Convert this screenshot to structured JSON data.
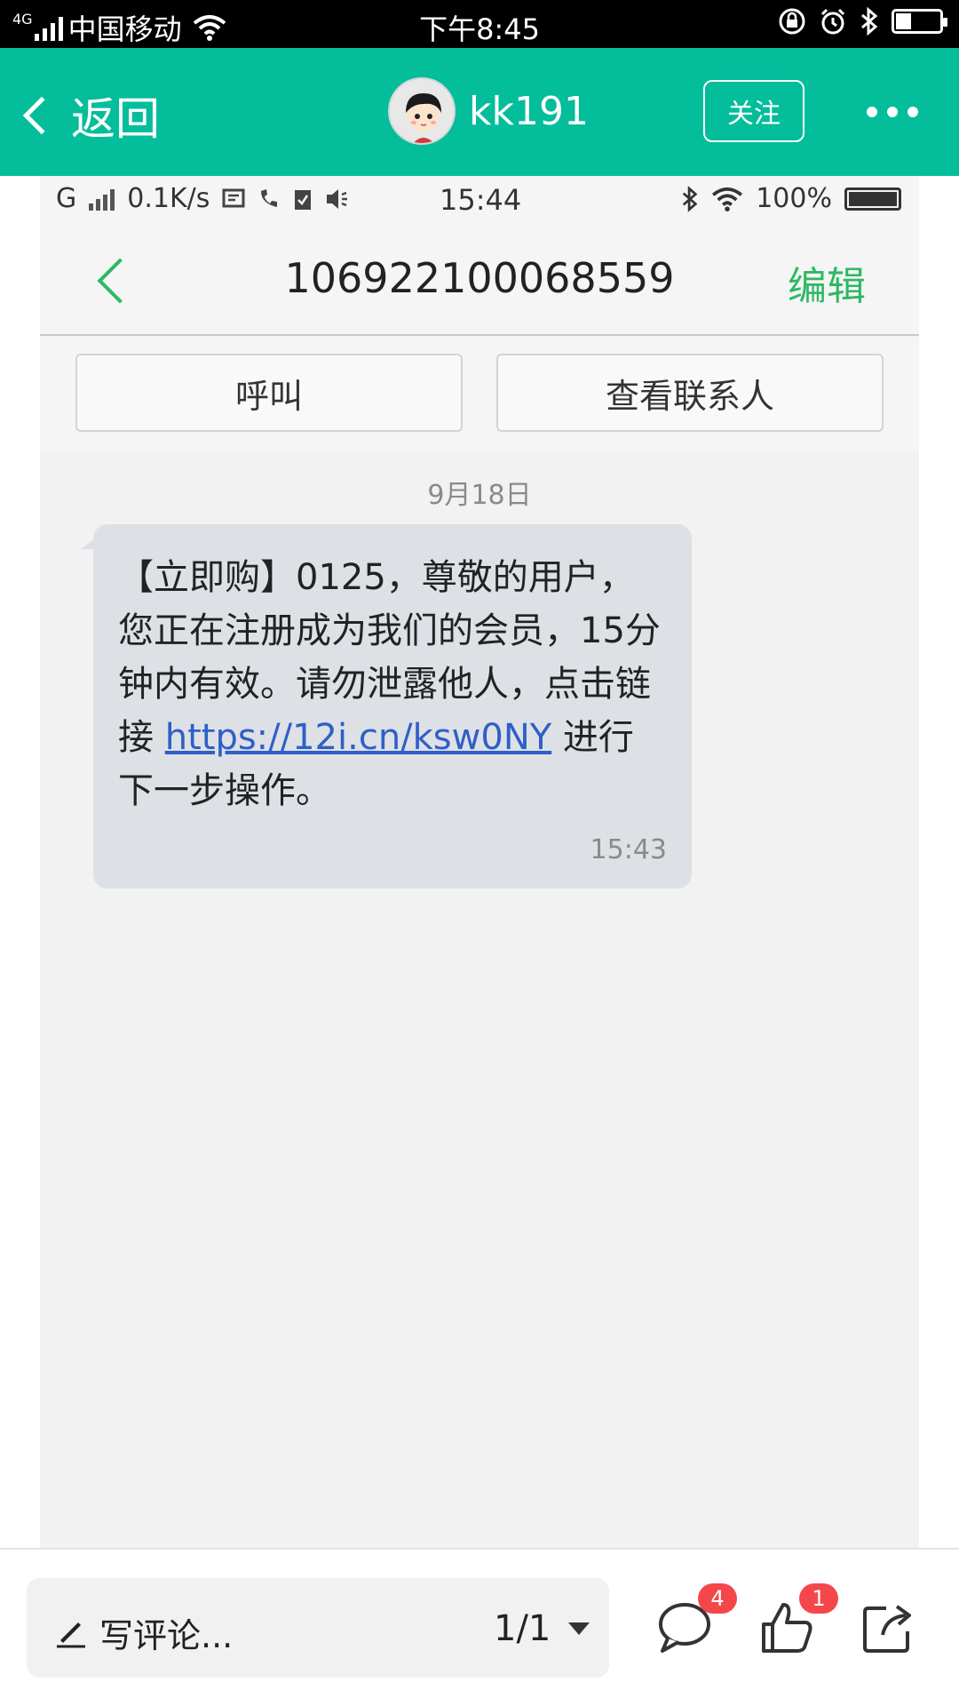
{
  "status_bar": {
    "network": "4G",
    "carrier": "中国移动",
    "time": "下午8:45",
    "battery_level": 0.35
  },
  "header": {
    "back_label": "返回",
    "username": "kk191",
    "follow_label": "关注",
    "accent_color": "#03bd9b"
  },
  "screenshot": {
    "status": {
      "network": "G",
      "speed": "0.1K/s",
      "time": "15:44",
      "battery": "100%"
    },
    "title_bar": {
      "number": "106922100068559",
      "edit_label": "编辑"
    },
    "buttons": {
      "call_label": "呼叫",
      "contact_label": "查看联系人"
    },
    "date_label": "9月18日",
    "message": {
      "text_before_link": "【立即购】0125，尊敬的用户，您正在注册成为我们的会员，15分钟内有效。请勿泄露他人，点击链接 ",
      "link": "https://12i.cn/ksw0NY",
      "text_after_link": " 进行下一步操作。",
      "time": "15:43"
    }
  },
  "bottom_bar": {
    "comment_placeholder": "写评论...",
    "pager": "1/1",
    "comment_count": "4",
    "like_count": "1"
  }
}
